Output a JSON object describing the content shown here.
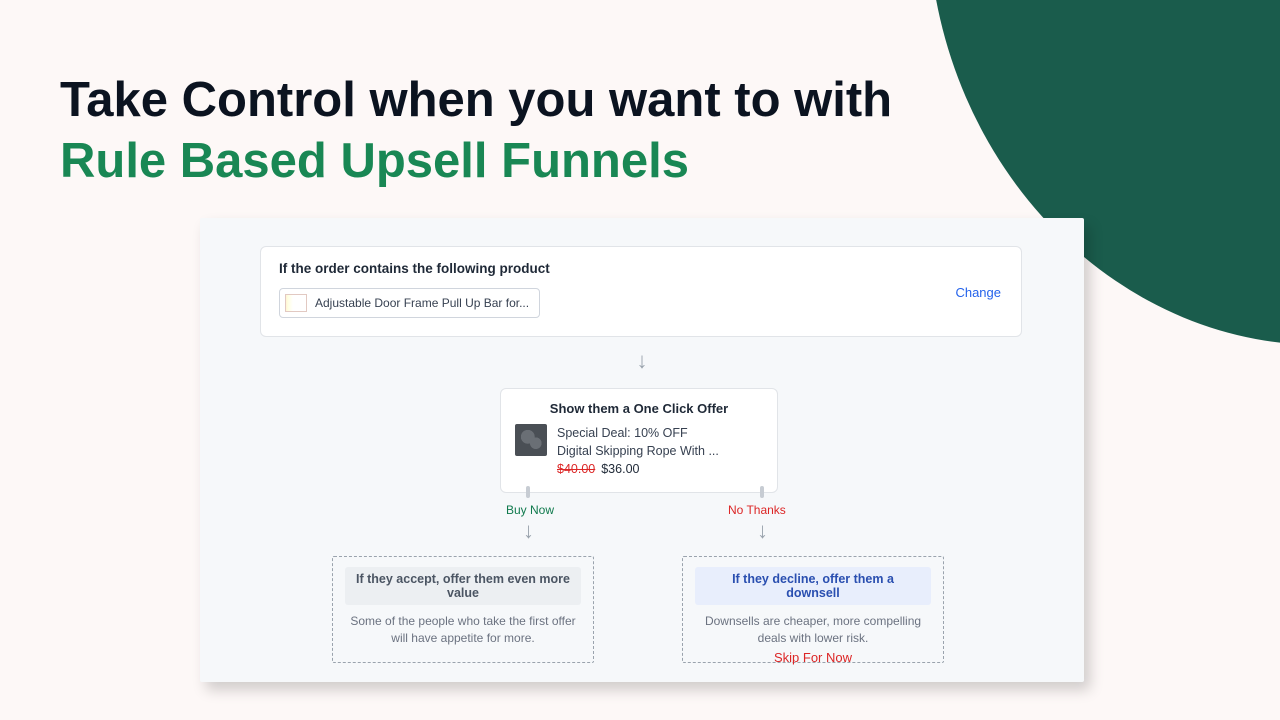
{
  "headline": {
    "line1": "Take Control when you want to with",
    "line2": "Rule Based Upsell Funnels"
  },
  "trigger": {
    "title": "If the order contains the following product",
    "change_label": "Change",
    "product_label": "Adjustable Door Frame Pull Up Bar for..."
  },
  "offer": {
    "title": "Show them a One Click Offer",
    "deal_line": "Special Deal: 10% OFF",
    "product_line": "Digital Skipping Rope With ...",
    "price_old": "$40.00",
    "price_new": "$36.00"
  },
  "branches": {
    "accept_label": "Buy Now",
    "decline_label": "No Thanks"
  },
  "outcome_accept": {
    "headline": "If they accept, offer them even more value",
    "desc": "Some of the people who take the first offer will have appetite for more."
  },
  "outcome_decline": {
    "headline": "If they decline, offer them a downsell",
    "desc": "Downsells are cheaper, more compelling deals with lower risk."
  },
  "skip_label": "Skip For Now",
  "colors": {
    "accent": "#198754",
    "blob": "#1a5c4c"
  }
}
